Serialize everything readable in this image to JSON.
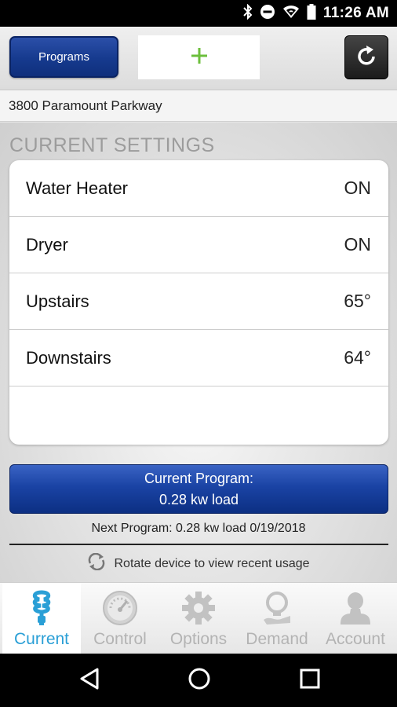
{
  "status_bar": {
    "time": "11:26 AM",
    "icons": [
      "bluetooth-icon",
      "do-not-disturb-icon",
      "wifi-icon",
      "battery-icon"
    ]
  },
  "toolbar": {
    "programs_label": "Programs",
    "add_symbol": "+",
    "refresh_icon": "refresh-icon"
  },
  "address": "3800 Paramount Parkway",
  "current_settings": {
    "title": "CURRENT SETTINGS",
    "rows": [
      {
        "name": "Water Heater",
        "value": "ON"
      },
      {
        "name": "Dryer",
        "value": "ON"
      },
      {
        "name": "Upstairs",
        "value": "65°"
      },
      {
        "name": "Downstairs",
        "value": "64°"
      }
    ]
  },
  "current_program": {
    "line1": "Current Program:",
    "line2": "0.28 kw load"
  },
  "next_program": "Next Program: 0.28 kw load 0/19/2018",
  "rotate_hint": "Rotate device to view recent usage",
  "bottom_nav": {
    "items": [
      {
        "label": "Current",
        "icon": "lightbulb-icon",
        "active": true
      },
      {
        "label": "Control",
        "icon": "gauge-icon",
        "active": false
      },
      {
        "label": "Options",
        "icon": "gear-icon",
        "active": false
      },
      {
        "label": "Demand",
        "icon": "lightbulb-hand-icon",
        "active": false
      },
      {
        "label": "Account",
        "icon": "user-icon",
        "active": false
      }
    ]
  },
  "colors": {
    "accent_blue": "#1a43a4",
    "active_tab": "#2a9fd6",
    "add_green": "#6cbf3c",
    "inactive_tab": "#b3b3b3"
  }
}
